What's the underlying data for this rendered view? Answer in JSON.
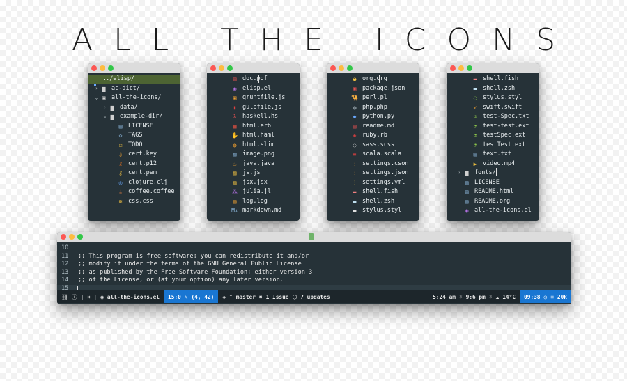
{
  "title": "ALL THE ICONS",
  "colors": {
    "window_bg": "#263238",
    "selection": "#4d6433",
    "accent_blue": "#1976d2"
  },
  "windows": [
    {
      "rows": [
        {
          "label": "../elisp/",
          "indent": 0,
          "arrow": "",
          "icon": "",
          "color": "#ffffff",
          "selected": true
        },
        {
          "label": "ac-dict/",
          "indent": 0,
          "arrow": "›",
          "icon": "▆",
          "color": "#d0d0d0"
        },
        {
          "label": "all-the-icons/",
          "indent": 0,
          "arrow": "⌄",
          "icon": "▣",
          "color": "#d0d0d0"
        },
        {
          "label": "data/",
          "indent": 1,
          "arrow": "›",
          "icon": "▆",
          "color": "#d0d0d0"
        },
        {
          "label": "example-dir/",
          "indent": 1,
          "arrow": "⌄",
          "icon": "▆",
          "color": "#d0d0d0"
        },
        {
          "label": "LICENSE",
          "indent": 2,
          "arrow": "",
          "icon": "▤",
          "color": "#8ab4d8"
        },
        {
          "label": "TAGS",
          "indent": 2,
          "arrow": "",
          "icon": "◇",
          "color": "#8ab4d8"
        },
        {
          "label": "TODO",
          "indent": 2,
          "arrow": "",
          "icon": "☑",
          "color": "#f0c040"
        },
        {
          "label": "cert.key",
          "indent": 2,
          "arrow": "",
          "icon": "⚷",
          "color": "#f0a030"
        },
        {
          "label": "cert.p12",
          "indent": 2,
          "arrow": "",
          "icon": "⚷",
          "color": "#e07020"
        },
        {
          "label": "cert.pem",
          "indent": 2,
          "arrow": "",
          "icon": "⚷",
          "color": "#f0c040"
        },
        {
          "label": "clojure.clj",
          "indent": 2,
          "arrow": "",
          "icon": "◎",
          "color": "#6aa9ff"
        },
        {
          "label": "coffee.coffee",
          "indent": 2,
          "arrow": "",
          "icon": "☕",
          "color": "#c07040"
        },
        {
          "label": "css.css",
          "indent": 2,
          "arrow": "",
          "icon": "≋",
          "color": "#f0c040"
        }
      ]
    },
    {
      "rows": [
        {
          "label": "doc.pdf",
          "indent": 0,
          "icon": "▤",
          "color": "#e05050"
        },
        {
          "label": "elisp.el",
          "indent": 0,
          "icon": "◉",
          "color": "#b070e0"
        },
        {
          "label": "gruntfile.js",
          "indent": 0,
          "icon": "▣",
          "color": "#f0a030"
        },
        {
          "label": "gulpfile.js",
          "indent": 0,
          "icon": "▮",
          "color": "#e04040"
        },
        {
          "label": "haskell.hs",
          "indent": 0,
          "icon": "λ",
          "color": "#e05050"
        },
        {
          "label": "html.erb",
          "indent": 0,
          "icon": "▦",
          "color": "#e05040"
        },
        {
          "label": "html.haml",
          "indent": 0,
          "icon": "✋",
          "color": "#f0c040"
        },
        {
          "label": "html.slim",
          "indent": 0,
          "icon": "◍",
          "color": "#f0a030"
        },
        {
          "label": "image.png",
          "indent": 0,
          "icon": "▨",
          "color": "#8ab4d8"
        },
        {
          "label": "java.java",
          "indent": 0,
          "icon": "♨",
          "color": "#f0a030"
        },
        {
          "label": "js.js",
          "indent": 0,
          "icon": "▨",
          "color": "#f0c040"
        },
        {
          "label": "jsx.jsx",
          "indent": 0,
          "icon": "▨",
          "color": "#f0c040"
        },
        {
          "label": "julia.jl",
          "indent": 0,
          "icon": "⁂",
          "color": "#b070e0"
        },
        {
          "label": "log.log",
          "indent": 0,
          "icon": "▤",
          "color": "#f0a030"
        },
        {
          "label": "markdown.md",
          "indent": 0,
          "icon": "M↓",
          "color": "#8ab4d8"
        }
      ]
    },
    {
      "rows": [
        {
          "label": "org.org",
          "indent": 0,
          "icon": "◕",
          "color": "#f0c040"
        },
        {
          "label": "package.json",
          "indent": 0,
          "icon": "▣",
          "color": "#e05050"
        },
        {
          "label": "perl.pl",
          "indent": 0,
          "icon": "🐪",
          "color": "#f0a030"
        },
        {
          "label": "php.php",
          "indent": 0,
          "icon": "◍",
          "color": "#b0bec5"
        },
        {
          "label": "python.py",
          "indent": 0,
          "icon": "◆",
          "color": "#6aa9ff"
        },
        {
          "label": "readme.md",
          "indent": 0,
          "icon": "▤",
          "color": "#e05050"
        },
        {
          "label": "ruby.rb",
          "indent": 0,
          "icon": "◈",
          "color": "#e04040"
        },
        {
          "label": "sass.scss",
          "indent": 0,
          "icon": "◌",
          "color": "#e0e0e0"
        },
        {
          "label": "scala.scala",
          "indent": 0,
          "icon": "≡",
          "color": "#e04040"
        },
        {
          "label": "settings.cson",
          "indent": 0,
          "icon": "⫶",
          "color": "#f0a030"
        },
        {
          "label": "settings.json",
          "indent": 0,
          "icon": "⫶",
          "color": "#f0a030"
        },
        {
          "label": "settings.yml",
          "indent": 0,
          "icon": "⫶",
          "color": "#f0c040"
        },
        {
          "label": "shell.fish",
          "indent": 0,
          "icon": "▬",
          "color": "#f08080"
        },
        {
          "label": "shell.zsh",
          "indent": 0,
          "icon": "▬",
          "color": "#c0e0f0"
        },
        {
          "label": "stylus.styl",
          "indent": 0,
          "icon": "▬",
          "color": "#e0e0e0"
        }
      ]
    },
    {
      "rows": [
        {
          "label": "shell.fish",
          "indent": 1,
          "arrow": "",
          "icon": "▬",
          "color": "#f08080"
        },
        {
          "label": "shell.zsh",
          "indent": 1,
          "arrow": "",
          "icon": "▬",
          "color": "#c0e0f0"
        },
        {
          "label": "stylus.styl",
          "indent": 1,
          "arrow": "",
          "icon": "◌",
          "color": "#8bc34a"
        },
        {
          "label": "swift.swift",
          "indent": 1,
          "arrow": "",
          "icon": "➶",
          "color": "#f0a030"
        },
        {
          "label": "test-Spec.txt",
          "indent": 1,
          "arrow": "",
          "icon": "⚗",
          "color": "#8bc34a"
        },
        {
          "label": "test-test.ext",
          "indent": 1,
          "arrow": "",
          "icon": "⚗",
          "color": "#8bc34a"
        },
        {
          "label": "testSpec.ext",
          "indent": 1,
          "arrow": "",
          "icon": "⚗",
          "color": "#8bc34a"
        },
        {
          "label": "testTest.ext",
          "indent": 1,
          "arrow": "",
          "icon": "⚗",
          "color": "#8bc34a"
        },
        {
          "label": "text.txt",
          "indent": 1,
          "arrow": "",
          "icon": "▤",
          "color": "#8ab4d8"
        },
        {
          "label": "video.mp4",
          "indent": 1,
          "arrow": "",
          "icon": "▶",
          "color": "#f0c040"
        },
        {
          "label": "fonts/",
          "indent": 0,
          "arrow": "›",
          "icon": "▆",
          "color": "#d0d0d0"
        },
        {
          "label": "LICENSE",
          "indent": 0,
          "arrow": "",
          "icon": "▤",
          "color": "#8ab4d8"
        },
        {
          "label": "README.html",
          "indent": 0,
          "arrow": "",
          "icon": "▤",
          "color": "#8ab4d8"
        },
        {
          "label": "README.org",
          "indent": 0,
          "arrow": "",
          "icon": "▤",
          "color": "#8ab4d8"
        },
        {
          "label": "all-the-icons.el",
          "indent": 0,
          "arrow": "",
          "icon": "◉",
          "color": "#b070e0"
        }
      ]
    }
  ],
  "editor": {
    "lines": [
      {
        "num": "10",
        "text": ""
      },
      {
        "num": "11",
        "text": ";; This program is free software; you can redistribute it and/or"
      },
      {
        "num": "12",
        "text": ";; modify it under the terms of the GNU General Public License"
      },
      {
        "num": "13",
        "text": ";; as published by the Free Software Foundation; either version 3"
      },
      {
        "num": "14",
        "text": ";; of the License, or (at your option) any later version."
      },
      {
        "num": "15",
        "text": ""
      }
    ],
    "modeline": {
      "flags": "| × |",
      "buffer": "all-the-icons.el",
      "position": "15:0",
      "selection": "(4, 42)",
      "branch": "master",
      "issues": "1 Issue",
      "updates": "7 updates",
      "sunrise": "5:24 am",
      "sunset": "9:6 pm",
      "weather": "14°C",
      "time": "09:38",
      "size": "20k"
    }
  }
}
